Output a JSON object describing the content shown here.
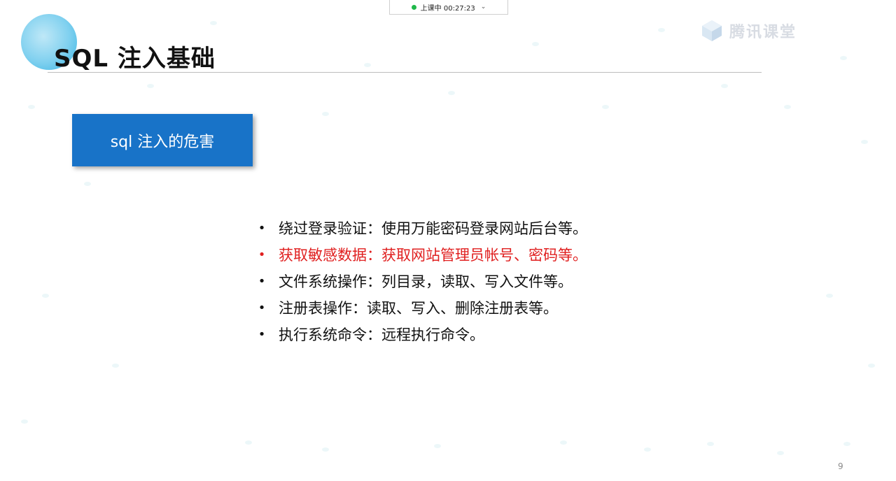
{
  "status": {
    "label": "上课中 00:27:23",
    "indicator_color": "#1fb84a"
  },
  "title": "SQL 注入基础",
  "watermark": {
    "text": "腾讯课堂",
    "icon": "brand-cube-icon"
  },
  "topic_box": {
    "label": "sql 注入的危害",
    "color": "#1873c8"
  },
  "bullets": [
    {
      "text": "绕过登录验证：使用万能密码登录网站后台等。",
      "highlight": false
    },
    {
      "text": "获取敏感数据：获取网站管理员帐号、密码等。",
      "highlight": true
    },
    {
      "text": "文件系统操作：列目录，读取、写入文件等。",
      "highlight": false
    },
    {
      "text": "注册表操作：读取、写入、删除注册表等。",
      "highlight": false
    },
    {
      "text": "执行系统命令：远程执行命令。",
      "highlight": false
    }
  ],
  "bullet_marker": "•",
  "highlight_color": "#e02020",
  "page_number": "9"
}
